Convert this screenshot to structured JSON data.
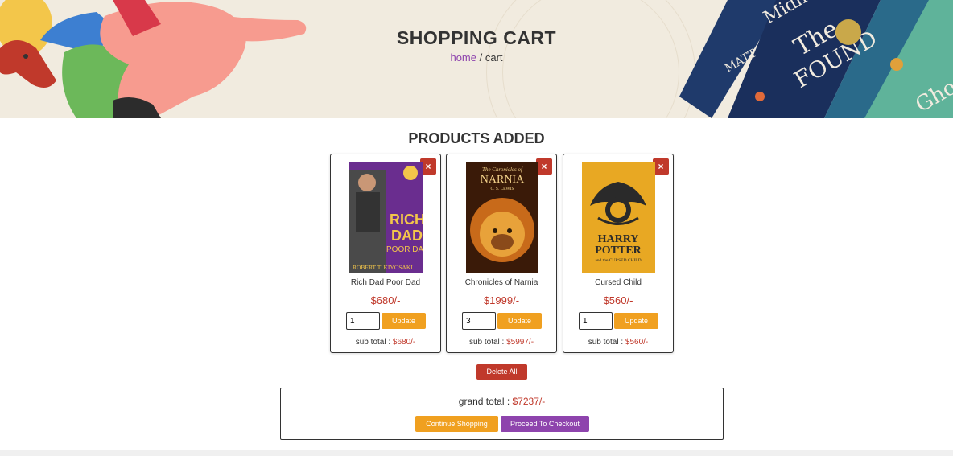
{
  "header": {
    "title": "SHOPPING CART",
    "breadcrumb_home": "home",
    "breadcrumb_sep": " / ",
    "breadcrumb_current": "cart"
  },
  "section_title": "PRODUCTS ADDED",
  "products": [
    {
      "name": "Rich Dad Poor Dad",
      "price": "$680/-",
      "quantity": "1",
      "update_label": "Update",
      "subtotal_label": "sub total : ",
      "subtotal_value": "$680/-",
      "remove_icon": "×",
      "cover": {
        "line1": "RICH",
        "line2": "DAD",
        "line3": "POOR DAD",
        "author": "ROBERT T. KIYOSAKI"
      }
    },
    {
      "name": "Chronicles of Narnia",
      "price": "$1999/-",
      "quantity": "3",
      "update_label": "Update",
      "subtotal_label": "sub total : ",
      "subtotal_value": "$5997/-",
      "remove_icon": "×",
      "cover": {
        "line1": "The Chronicles of",
        "line2": "NARNIA",
        "line3": "C. S. LEWIS"
      }
    },
    {
      "name": "Cursed Child",
      "price": "$560/-",
      "quantity": "1",
      "update_label": "Update",
      "subtotal_label": "sub total : ",
      "subtotal_value": "$560/-",
      "remove_icon": "×",
      "cover": {
        "line1": "HARRY",
        "line2": "POTTER",
        "line3": "and the CURSED CHILD"
      }
    }
  ],
  "delete_all_label": "Delete All",
  "totals": {
    "label": "grand total : ",
    "value": "$7237/-",
    "continue_label": "Continue Shopping",
    "checkout_label": "Proceed To Checkout"
  },
  "colors": {
    "accent_orange": "#f0a020",
    "accent_purple": "#8e44ad",
    "danger_red": "#c0392b",
    "banner_bg": "#f1ebdf"
  }
}
